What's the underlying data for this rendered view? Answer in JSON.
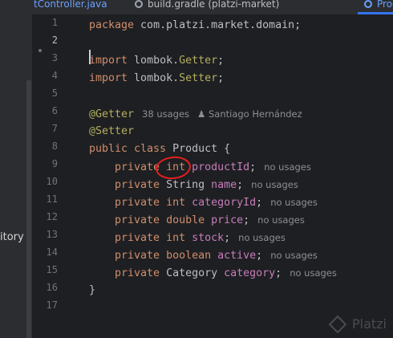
{
  "tabs": [
    {
      "label": "tController.java",
      "color": "#6aa0ff"
    },
    {
      "label": "build.gradle (platzi-market)",
      "color": "#bcbec4"
    },
    {
      "label": "Product.",
      "color": "#6aa0ff"
    }
  ],
  "sidebar": {
    "label": "itory"
  },
  "line_numbers": [
    "1",
    "2",
    "3",
    "4",
    "5",
    "6",
    "7",
    "8",
    "9",
    "10",
    "11",
    "12",
    "13",
    "14",
    "15",
    "16",
    "17"
  ],
  "current_line": 2,
  "code": {
    "l1": {
      "kw": "package",
      "rest": " com.platzi.market.domain;"
    },
    "l3": {
      "kw": "import",
      "rest": " lombok.",
      "cls": "Getter",
      "end": ";"
    },
    "l4": {
      "kw": "import",
      "rest": " lombok.",
      "cls": "Setter",
      "end": ";"
    },
    "l6": {
      "ann": "@Getter",
      "hint_usages": "38 usages",
      "hint_author": "Santiago Hernández"
    },
    "l7": {
      "ann": "@Setter"
    },
    "l8": {
      "kw": "public class",
      "rest": " Product {"
    },
    "fields": [
      {
        "kw": "private",
        "type": "int",
        "type_kw": true,
        "name": "productId",
        "hint": "no usages"
      },
      {
        "kw": "private",
        "type": "String",
        "type_kw": false,
        "name": "name",
        "hint": "no usages"
      },
      {
        "kw": "private",
        "type": "int",
        "type_kw": true,
        "name": "categoryId",
        "hint": "no usages"
      },
      {
        "kw": "private",
        "type": "double",
        "type_kw": true,
        "name": "price",
        "hint": "no usages"
      },
      {
        "kw": "private",
        "type": "int",
        "type_kw": true,
        "name": "stock",
        "hint": "no usages"
      },
      {
        "kw": "private",
        "type": "boolean",
        "type_kw": true,
        "name": "active",
        "hint": "no usages"
      },
      {
        "kw": "private",
        "type": "Category",
        "type_kw": false,
        "name": "category",
        "hint": "no usages"
      }
    ],
    "l16": {
      "rest": "}"
    }
  },
  "watermark": {
    "label": "Platzi"
  },
  "colors": {
    "keyword": "#cf8e6d",
    "annotation": "#b3ae60",
    "field": "#c77dbb",
    "hint": "#8c8f94",
    "highlight_circle": "#e32020"
  }
}
